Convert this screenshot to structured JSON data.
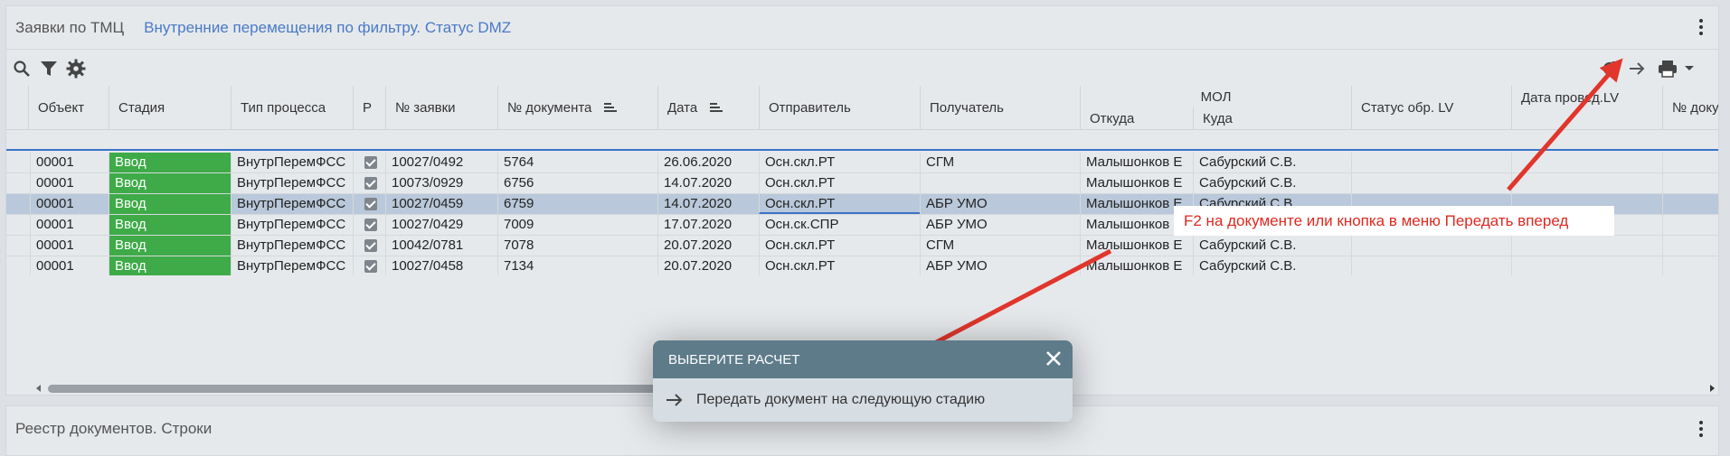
{
  "header": {
    "left_title": "Заявки по ТМЦ",
    "right_title": "Внутренние перемещения по фильтру. Статус DMZ"
  },
  "toolbar": {
    "left_icons": [
      "search-icon",
      "filter-icon",
      "gear-icon"
    ],
    "right_icons": [
      "refresh-icon",
      "arrow-right-icon",
      "print-icon",
      "chevron-down-icon"
    ]
  },
  "table": {
    "columns": {
      "object": "Объект",
      "stage": "Стадия",
      "process_type": "Тип процесса",
      "p": "Р",
      "request_no": "№ заявки",
      "document_no": "№ документа",
      "date": "Дата",
      "sender": "Отправитель",
      "recipient": "Получатель",
      "mol": "МОЛ",
      "mol_from": "Откуда",
      "mol_to": "Куда",
      "lv_status": "Статус обр. LV",
      "posting_date": "Дата провед.LV",
      "doc_no_cut": "№ докум"
    },
    "rows": [
      {
        "object": "00001",
        "stage": "Ввод",
        "process_type": "ВнутрПеремФСС",
        "request_no": "10027/0492",
        "document_no": "5764",
        "date": "26.06.2020",
        "sender": "Осн.скл.РТ",
        "recipient": "СГМ",
        "mol_from": "Малышонков Е",
        "mol_to": "Сабурский С.В.",
        "selected": false
      },
      {
        "object": "00001",
        "stage": "Ввод",
        "process_type": "ВнутрПеремФСС",
        "request_no": "10073/0929",
        "document_no": "6756",
        "date": "14.07.2020",
        "sender": "Осн.скл.РТ",
        "recipient": "",
        "mol_from": "Малышонков Е",
        "mol_to": "Сабурский С.В.",
        "selected": false
      },
      {
        "object": "00001",
        "stage": "Ввод",
        "process_type": "ВнутрПеремФСС",
        "request_no": "10027/0459",
        "document_no": "6759",
        "date": "14.07.2020",
        "sender": "Осн.скл.РТ",
        "recipient": "АБР УМО",
        "mol_from": "Малышонков Е",
        "mol_to": "Сабурский С.В.",
        "selected": true
      },
      {
        "object": "00001",
        "stage": "Ввод",
        "process_type": "ВнутрПеремФСС",
        "request_no": "10027/0429",
        "document_no": "7009",
        "date": "17.07.2020",
        "sender": "Осн.ск.СПР",
        "recipient": "АБР УМО",
        "mol_from": "Малышонков",
        "mol_to": "",
        "selected": false
      },
      {
        "object": "00001",
        "stage": "Ввод",
        "process_type": "ВнутрПеремФСС",
        "request_no": "10042/0781",
        "document_no": "7078",
        "date": "20.07.2020",
        "sender": "Осн.скл.РТ",
        "recipient": "СГМ",
        "mol_from": "Малышонков Е",
        "mol_to": "Сабурский С.В.",
        "selected": false
      },
      {
        "object": "00001",
        "stage": "Ввод",
        "process_type": "ВнутрПеремФСС",
        "request_no": "10027/0458",
        "document_no": "7134",
        "date": "20.07.2020",
        "sender": "Осн.скл.РТ",
        "recipient": "АБР УМО",
        "mol_from": "Малышонков Е",
        "mol_to": "Сабурский С.В.",
        "selected": false
      }
    ]
  },
  "bottom_panel": {
    "title": "Реестр документов. Строки"
  },
  "dialog": {
    "title": "ВЫБЕРИТЕ РАСЧЕТ",
    "item_label": "Передать документ на следующую стадию"
  },
  "annotation": {
    "text": "F2 на документе или кнопка в меню Передать вперед",
    "arrow_color": "#e0362c"
  },
  "colors": {
    "stage_green": "#3eab48",
    "selected_row": "#b9c8da",
    "header_link": "#4a7ac7",
    "dialog_header": "#5e7b8a"
  }
}
